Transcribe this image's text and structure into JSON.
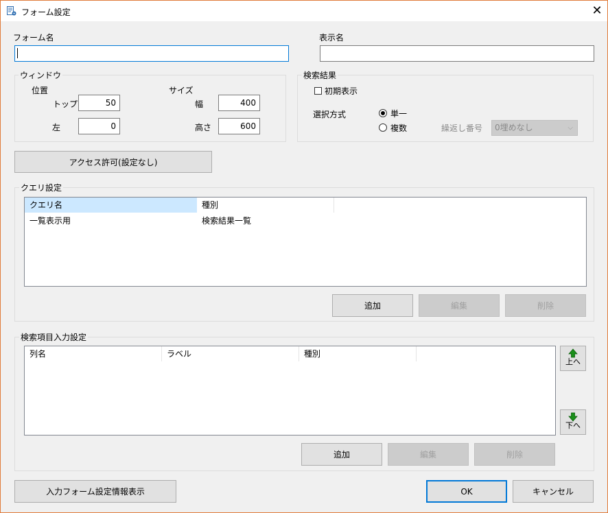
{
  "window": {
    "title": "フォーム設定",
    "close_glyph": "✕",
    "accent": "#0078d7",
    "border": "#e07b39"
  },
  "form_name": {
    "label": "フォーム名",
    "value": ""
  },
  "display_name": {
    "label": "表示名",
    "value": ""
  },
  "window_group": {
    "title": "ウィンドウ",
    "position_label": "位置",
    "top_label": "トップ",
    "top_value": "50",
    "left_label": "左",
    "left_value": "0",
    "size_label": "サイズ",
    "width_label": "幅",
    "width_value": "400",
    "height_label": "高さ",
    "height_value": "600"
  },
  "search_results": {
    "title": "検索結果",
    "initial_display_label": "初期表示",
    "initial_display_checked": false,
    "selection_label": "選択方式",
    "single_label": "単一",
    "multi_label": "複数",
    "selected_mode": "単一",
    "repeat_number_label": "繰返し番号",
    "repeat_number_value": "0埋めなし"
  },
  "access_button": "アクセス許可(設定なし)",
  "query_settings": {
    "title": "クエリ設定",
    "columns": [
      "クエリ名",
      "種別"
    ],
    "rows": [
      {
        "name": "一覧表示用",
        "type": "検索結果一覧"
      }
    ],
    "add_button": "追加",
    "edit_button": "編集",
    "delete_button": "削除"
  },
  "search_input_settings": {
    "title": "検索項目入力設定",
    "columns": [
      "列名",
      "ラベル",
      "種別"
    ],
    "rows": [],
    "up_button": "上へ",
    "down_button": "下へ",
    "add_button": "追加",
    "edit_button": "編集",
    "delete_button": "削除"
  },
  "footer": {
    "info_button": "入力フォーム設定情報表示",
    "ok_button": "OK",
    "cancel_button": "キャンセル"
  }
}
